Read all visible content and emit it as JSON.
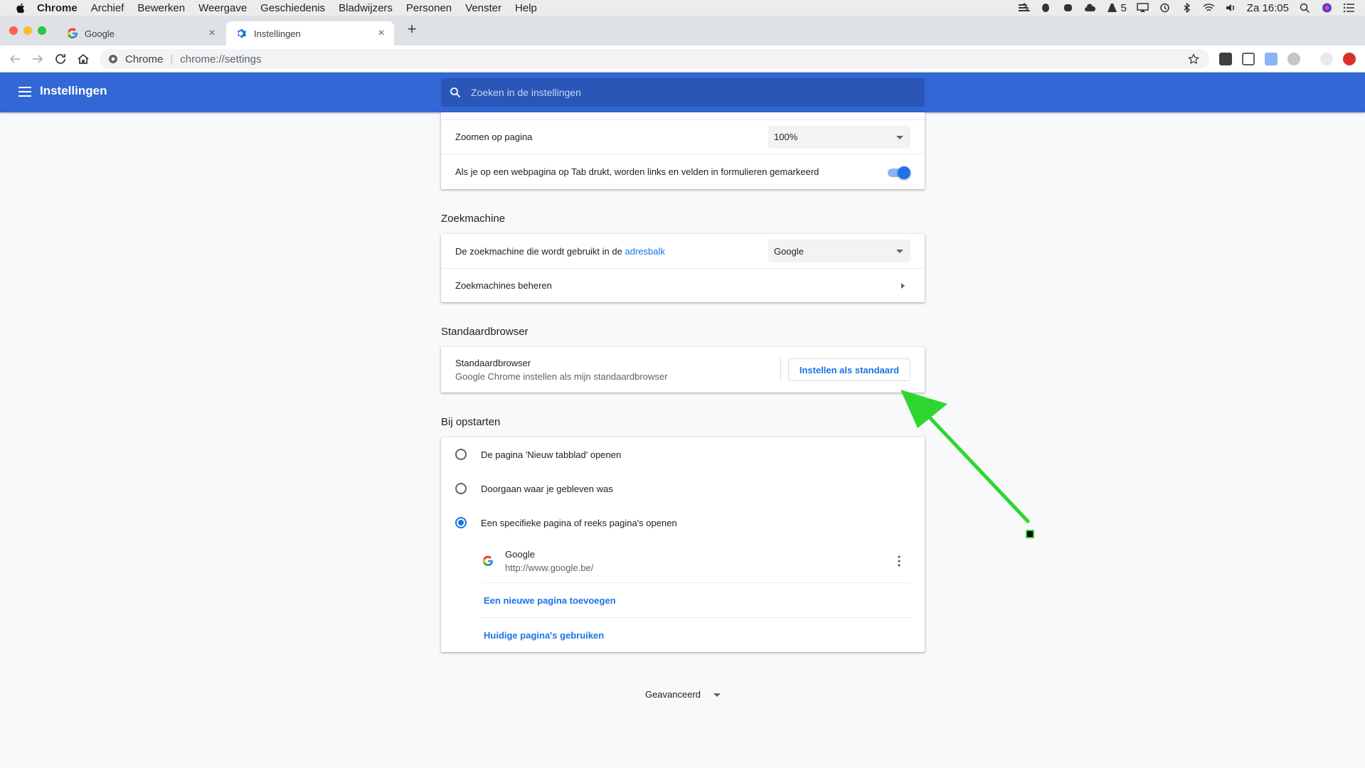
{
  "menubar": {
    "app": "Chrome",
    "items": [
      "Archief",
      "Bewerken",
      "Weergave",
      "Geschiedenis",
      "Bladwijzers",
      "Personen",
      "Venster",
      "Help"
    ],
    "battery_count": "5",
    "clock": "Za 16:05"
  },
  "tabs": [
    {
      "title": "Google",
      "icon": "google-favicon"
    },
    {
      "title": "Instellingen",
      "icon": "gear-icon",
      "active": true
    }
  ],
  "omnibox": {
    "scheme": "Chrome",
    "url": "chrome://settings"
  },
  "header": {
    "title": "Instellingen",
    "search_placeholder": "Zoeken in de instellingen"
  },
  "appearance": {
    "zoom_label": "Zoomen op pagina",
    "zoom_value": "100%",
    "tab_highlight_label": "Als je op een webpagina op Tab drukt, worden links en velden in formulieren gemarkeerd",
    "tab_highlight_enabled": true
  },
  "search_engine": {
    "title": "Zoekmachine",
    "label_prefix": "De zoekmachine die wordt gebruikt in de",
    "label_link": "adresbalk",
    "value": "Google",
    "manage_label": "Zoekmachines beheren"
  },
  "default_browser": {
    "title": "Standaardbrowser",
    "row_title": "Standaardbrowser",
    "row_subtitle": "Google Chrome instellen als mijn standaardbrowser",
    "button_label": "Instellen als standaard"
  },
  "startup": {
    "title": "Bij opstarten",
    "options": [
      {
        "label": "De pagina 'Nieuw tabblad' openen",
        "checked": false
      },
      {
        "label": "Doorgaan waar je gebleven was",
        "checked": false
      },
      {
        "label": "Een specifieke pagina of reeks pagina's openen",
        "checked": true
      }
    ],
    "page": {
      "name": "Google",
      "url": "http://www.google.be/"
    },
    "add_page_label": "Een nieuwe pagina toevoegen",
    "use_current_label": "Huidige pagina's gebruiken"
  },
  "advanced_label": "Geavanceerd",
  "colors": {
    "header_blue": "#3367d6",
    "accent": "#1a73e8",
    "annotation_arrow": "#2ed62e"
  }
}
